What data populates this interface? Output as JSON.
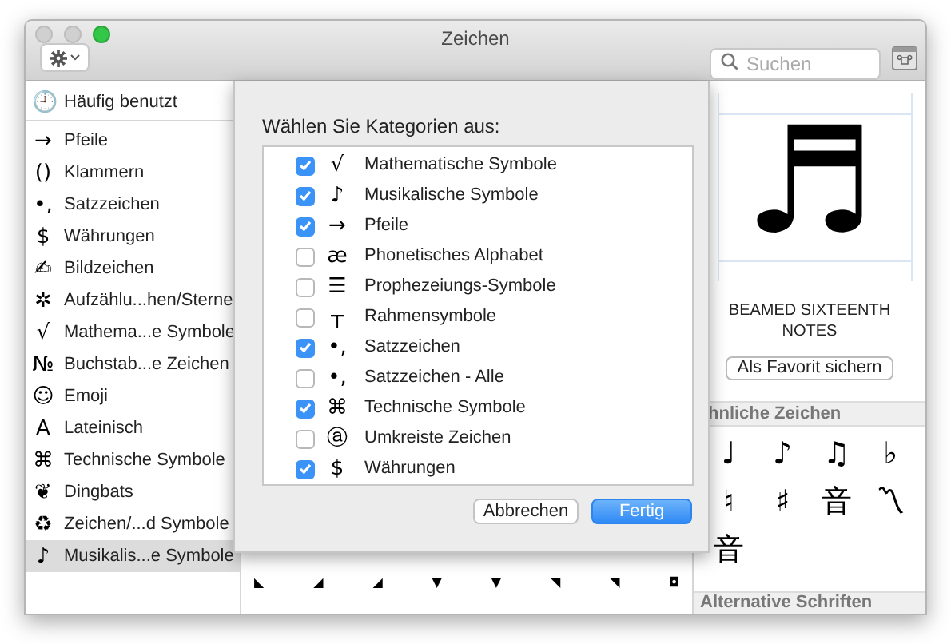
{
  "window": {
    "title": "Zeichen"
  },
  "toolbar": {
    "search": {
      "placeholder": "Suchen"
    }
  },
  "sidebar": {
    "items": [
      {
        "icon": "🕘",
        "label": "Häufig benutzt",
        "selected": false
      },
      {
        "icon": "→",
        "label": "Pfeile",
        "selected": false
      },
      {
        "icon": "()",
        "label": "Klammern",
        "selected": false
      },
      {
        "icon": "•,",
        "label": "Satzzeichen",
        "selected": false
      },
      {
        "icon": "$",
        "label": "Währungen",
        "selected": false
      },
      {
        "icon": "✍",
        "label": "Bildzeichen",
        "selected": false
      },
      {
        "icon": "✲",
        "label": "Aufzählu...hen/Sterne",
        "selected": false
      },
      {
        "icon": "√",
        "label": "Mathema...e Symbole",
        "selected": false
      },
      {
        "icon": "№",
        "label": "Buchstab...e Zeichen",
        "selected": false
      },
      {
        "icon": "☺",
        "label": "Emoji",
        "selected": false
      },
      {
        "icon": "A",
        "label": "Lateinisch",
        "selected": false
      },
      {
        "icon": "⌘",
        "label": "Technische Symbole",
        "selected": false
      },
      {
        "icon": "❦",
        "label": "Dingbats",
        "selected": false
      },
      {
        "icon": "♻",
        "label": "Zeichen/...d Symbole",
        "selected": false
      },
      {
        "icon": "♪",
        "label": "Musikalis...e Symbole",
        "selected": true
      }
    ]
  },
  "grid": {
    "characters": [
      "◣",
      "◢",
      "◢",
      "▼",
      "▼",
      "◥",
      "◥",
      "◘"
    ]
  },
  "sheet": {
    "prompt": "Wählen Sie Kategorien aus:",
    "categories": [
      {
        "icon": "√",
        "label": "Mathematische Symbole",
        "checked": true
      },
      {
        "icon": "♪",
        "label": "Musikalische Symbole",
        "checked": true
      },
      {
        "icon": "→",
        "label": "Pfeile",
        "checked": true
      },
      {
        "icon": "æ",
        "label": "Phonetisches Alphabet",
        "checked": false
      },
      {
        "icon": "☰",
        "label": "Prophezeiungs-Symbole",
        "checked": false
      },
      {
        "icon": "┬",
        "label": "Rahmensymbole",
        "checked": false
      },
      {
        "icon": "•,",
        "label": "Satzzeichen",
        "checked": true
      },
      {
        "icon": "•,",
        "label": "Satzzeichen - Alle",
        "checked": false
      },
      {
        "icon": "⌘",
        "label": "Technische Symbole",
        "checked": true
      },
      {
        "icon": "ⓐ",
        "label": "Umkreiste Zeichen",
        "checked": false
      },
      {
        "icon": "$",
        "label": "Währungen",
        "checked": true
      }
    ],
    "buttons": [
      {
        "label": "Abbrechen",
        "kind": "secondary"
      },
      {
        "label": "Fertig",
        "kind": "primary"
      }
    ]
  },
  "detail": {
    "glyph": "♬",
    "name": "BEAMED SIXTEENTH NOTES",
    "favorite_button": "Als Favorit sichern",
    "similar_header": "hnliche Zeichen",
    "similar": [
      "♩",
      "♪",
      "♫",
      "♭",
      "♮",
      "♯",
      "音",
      "〽",
      "音"
    ],
    "alternative_header": "Alternative Schriften"
  }
}
